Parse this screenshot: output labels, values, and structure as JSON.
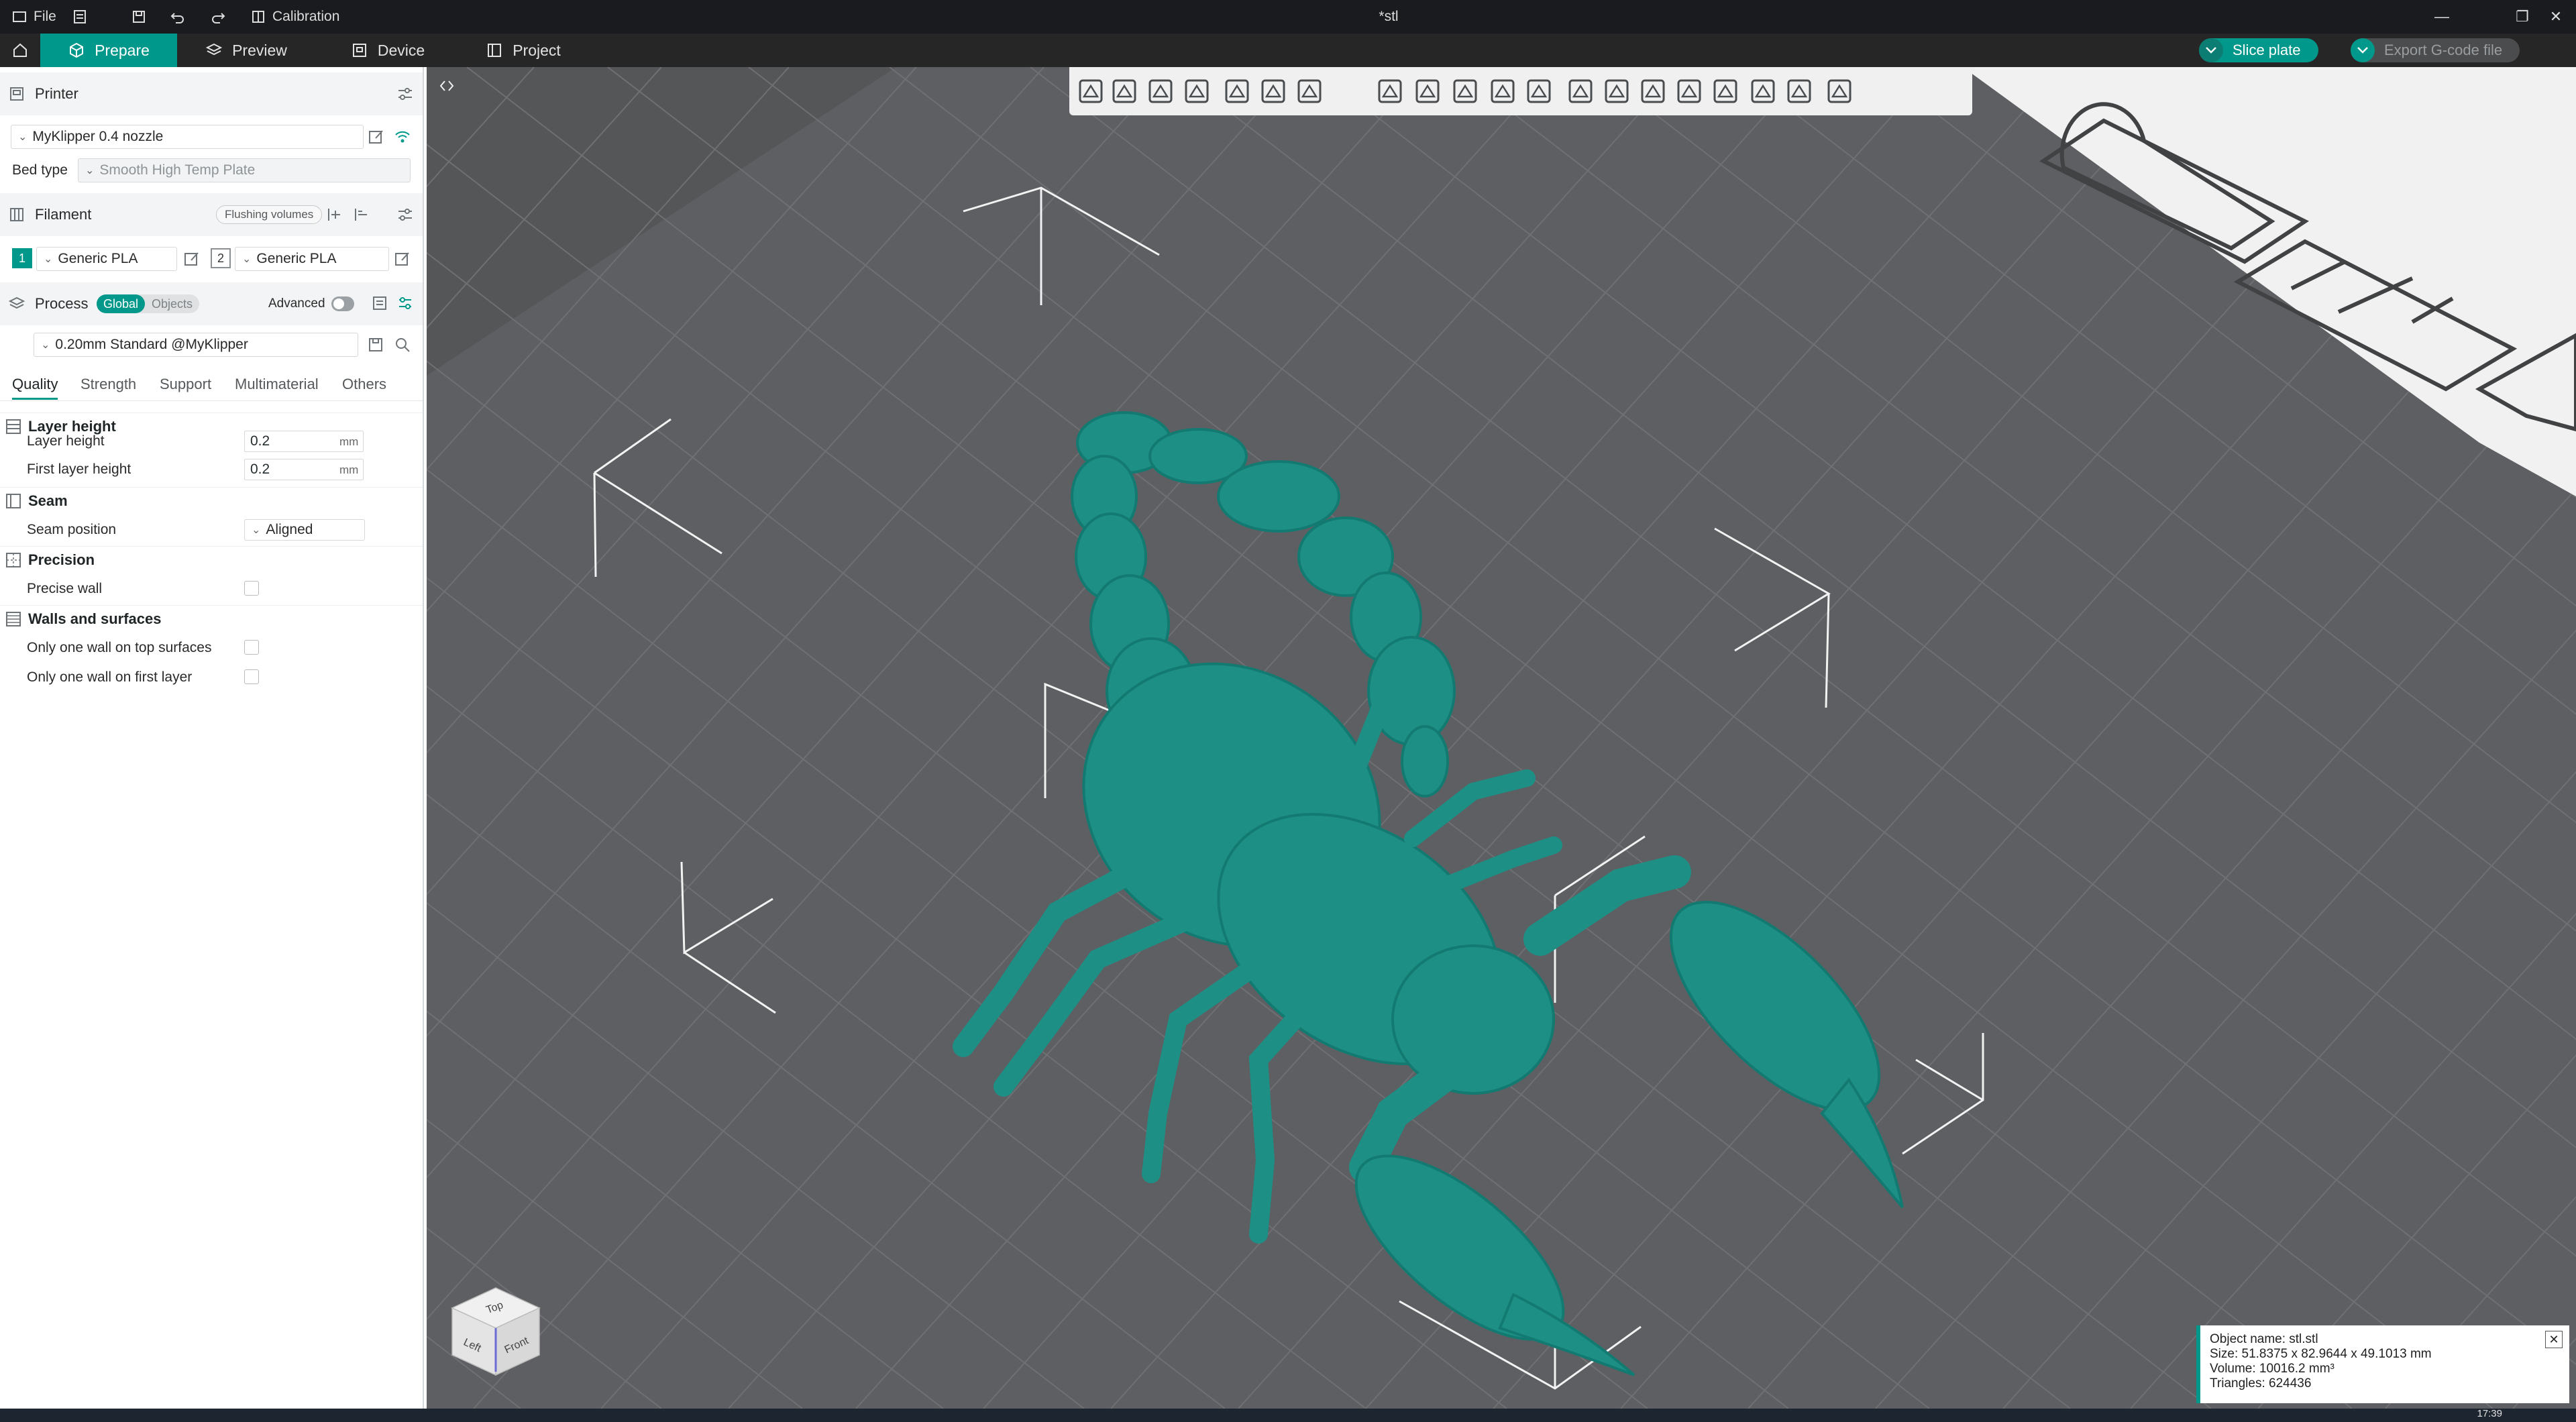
{
  "window": {
    "file_menu": "File",
    "calibration": "Calibration",
    "title": "*stl"
  },
  "tabs": [
    {
      "label": "Prepare",
      "icon": "cube-icon",
      "active": true
    },
    {
      "label": "Preview",
      "icon": "layers-icon",
      "active": false
    },
    {
      "label": "Device",
      "icon": "device-icon",
      "active": false
    },
    {
      "label": "Project",
      "icon": "project-icon",
      "active": false
    }
  ],
  "actions": {
    "slice": "Slice plate",
    "export": "Export G-code file"
  },
  "printer": {
    "header": "Printer",
    "preset": "MyKlipper 0.4 nozzle",
    "bed_label": "Bed type",
    "bed_value": "Smooth High Temp Plate"
  },
  "filament": {
    "header": "Filament",
    "flushing": "Flushing volumes",
    "slots": [
      {
        "index": "1",
        "name": "Generic PLA"
      },
      {
        "index": "2",
        "name": "Generic PLA"
      }
    ]
  },
  "process": {
    "header": "Process",
    "global": "Global",
    "objects": "Objects",
    "advanced": "Advanced",
    "preset": "0.20mm Standard @MyKlipper",
    "subtabs": [
      "Quality",
      "Strength",
      "Support",
      "Multimaterial",
      "Others"
    ],
    "groups": {
      "layer_height": {
        "title": "Layer height",
        "layer_height_label": "Layer height",
        "layer_height_value": "0.2",
        "first_layer_label": "First layer height",
        "first_layer_value": "0.2",
        "unit": "mm"
      },
      "seam": {
        "title": "Seam",
        "position_label": "Seam position",
        "position_value": "Aligned"
      },
      "precision": {
        "title": "Precision",
        "precise_wall": "Precise wall"
      },
      "walls": {
        "title": "Walls and surfaces",
        "top_only": "Only one wall on top surfaces",
        "first_only": "Only one wall on first layer"
      }
    }
  },
  "viewcube": {
    "top": "Top",
    "left": "Left",
    "front": "Front"
  },
  "object_info": {
    "name": "Object name: stl.stl",
    "size": "Size: 51.8375 x 82.9644 x 49.1013 mm",
    "volume": "Volume: 10016.2 mm³",
    "triangles": "Triangles: 624436"
  },
  "taskbar": {
    "time": "17:39"
  },
  "colors": {
    "accent": "#00988a",
    "model": "#1d8f85",
    "viewport": "#555658",
    "titlebar": "#1a1b1e"
  }
}
